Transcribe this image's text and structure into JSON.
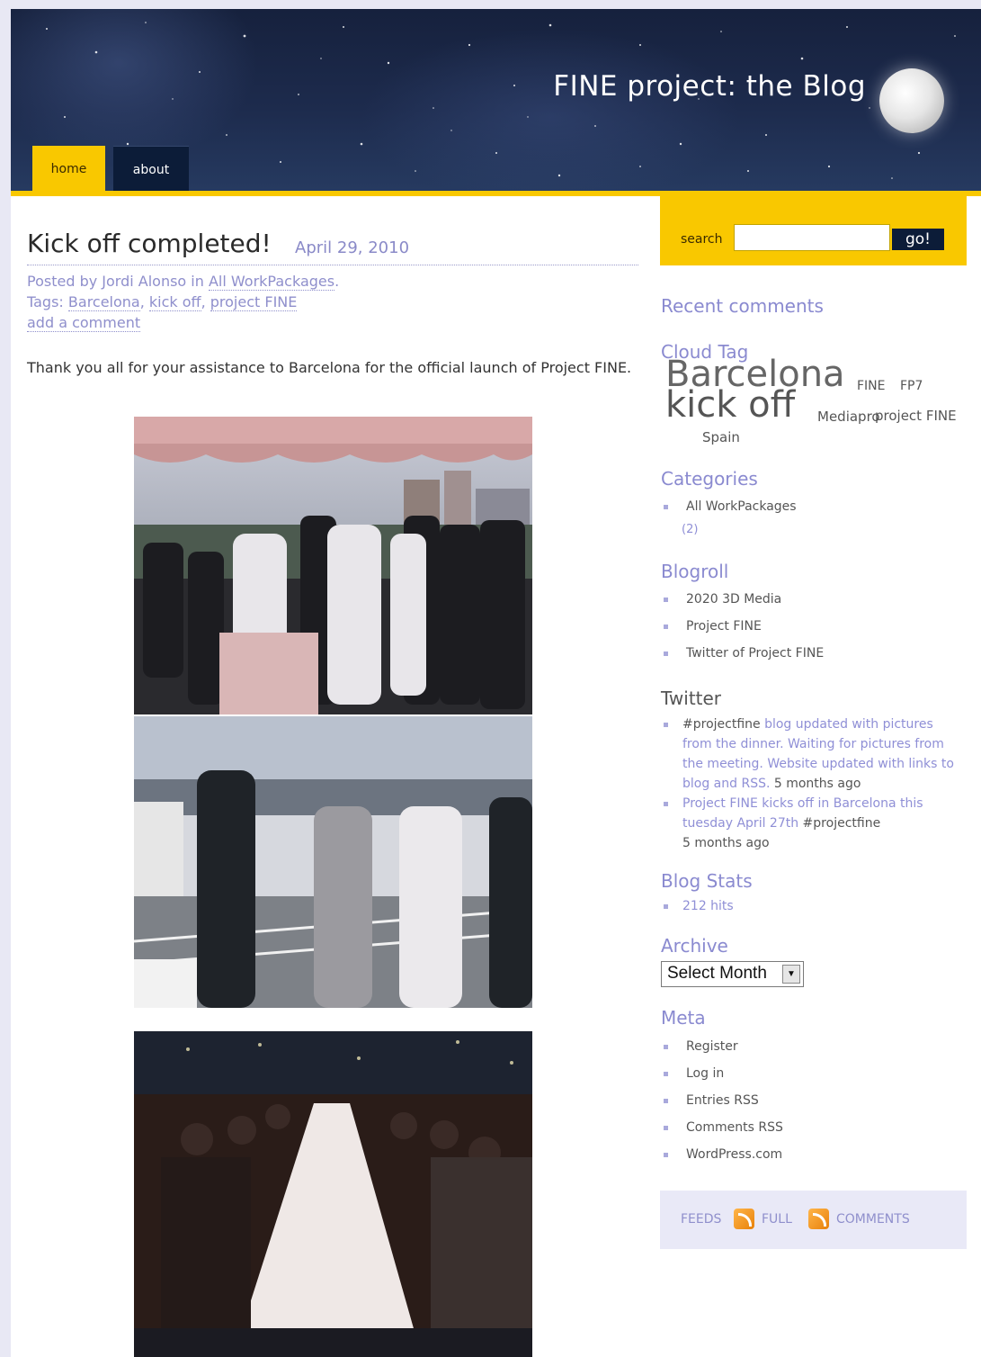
{
  "header": {
    "site_title": "FINE project: the Blog",
    "nav": [
      {
        "label": "home",
        "active": true
      },
      {
        "label": "about",
        "active": false
      }
    ]
  },
  "post": {
    "title": "Kick off completed!",
    "date": "April 29, 2010",
    "posted_by_prefix": "Posted by ",
    "author": "Jordi Alonso",
    "in_word": " in ",
    "category": "All WorkPackages",
    "period": ".",
    "tags_label": "Tags: ",
    "tags": [
      "Barcelona",
      "kick off",
      "project FINE"
    ],
    "add_comment": "add a comment",
    "body": "Thank you all for your assistance to Barcelona for the official launch of Project FINE."
  },
  "sidebar": {
    "search": {
      "label": "search",
      "button": "go!",
      "value": ""
    },
    "recent_comments": "Recent comments",
    "cloud_tag": {
      "heading": "Cloud Tag",
      "tags": [
        "Barcelona",
        "FINE",
        "FP7",
        "kick off",
        "Mediapro",
        "project FINE",
        "Spain"
      ]
    },
    "categories": {
      "heading": "Categories",
      "items": [
        {
          "label": "All WorkPackages",
          "count": "(2)"
        }
      ]
    },
    "blogroll": {
      "heading": "Blogroll",
      "items": [
        "2020 3D Media",
        "Project FINE",
        "Twitter of Project FINE"
      ]
    },
    "twitter": {
      "heading": "Twitter",
      "tweets": [
        {
          "hashtag": "#projectfine",
          "link": " blog updated with pictures from the dinner. Waiting for pictures from the meeting. Website updated with links to blog and RSS.",
          "time": " 5 months ago"
        },
        {
          "link": "Project FINE kicks off in Barcelona this tuesday April 27th",
          "hashtag": " #projectfine",
          "time": "5 months ago"
        }
      ]
    },
    "blog_stats": {
      "heading": "Blog Stats",
      "hits": "212 hits"
    },
    "archive": {
      "heading": "Archive",
      "select": "Select Month"
    },
    "meta": {
      "heading": "Meta",
      "items": [
        "Register",
        "Log in",
        "Entries RSS",
        "Comments RSS",
        "WordPress.com"
      ]
    },
    "feeds": {
      "label": "FEEDS",
      "full": "FULL",
      "comments": "COMMENTS"
    }
  },
  "colors": {
    "accent_yellow": "#f9c800",
    "link_purple": "#8f8fcc",
    "nav_dark": "#0c1c38"
  }
}
